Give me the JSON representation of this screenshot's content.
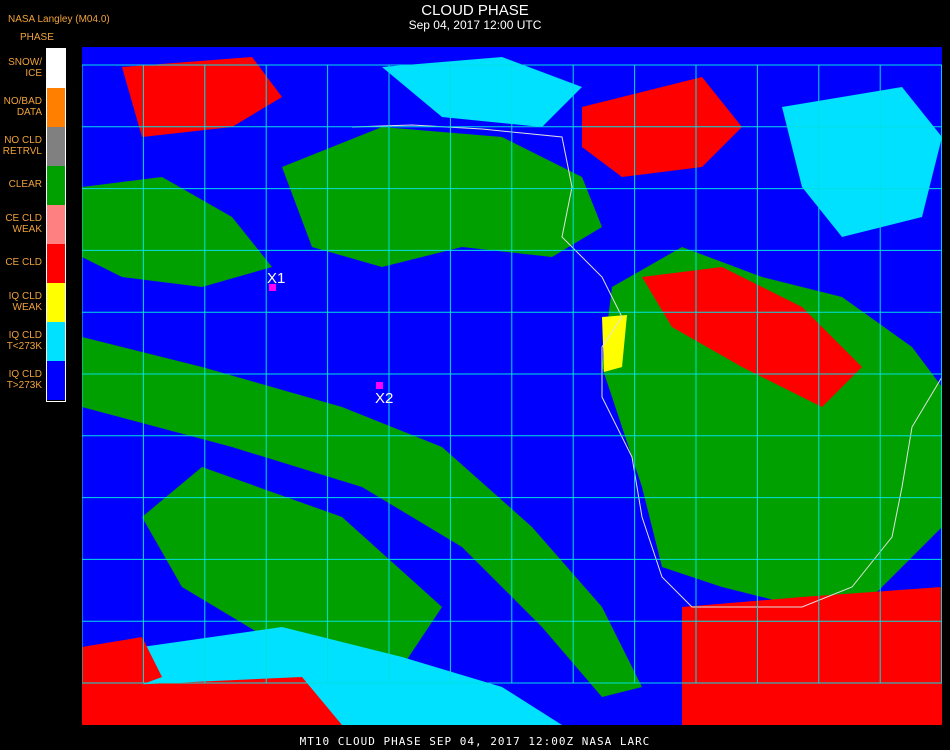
{
  "header": {
    "source": "NASA Langley (M04.0)",
    "phase_label": "PHASE",
    "title": "CLOUD PHASE",
    "datetime": "Sep 04, 2017 12:00 UTC"
  },
  "legend": [
    {
      "label_lines": [
        "SNOW/",
        "ICE"
      ],
      "color": "#ffffff"
    },
    {
      "label_lines": [
        "NO/BAD",
        "DATA"
      ],
      "color": "#ff8000"
    },
    {
      "label_lines": [
        "NO CLD",
        "RETRVL"
      ],
      "color": "#808080"
    },
    {
      "label_lines": [
        "CLEAR"
      ],
      "color": "#00a000"
    },
    {
      "label_lines": [
        "CE CLD",
        "WEAK"
      ],
      "color": "#ff8080"
    },
    {
      "label_lines": [
        "CE CLD"
      ],
      "color": "#ff0000"
    },
    {
      "label_lines": [
        "IQ CLD",
        "WEAK"
      ],
      "color": "#ffff00"
    },
    {
      "label_lines": [
        "IQ CLD",
        "T<273K"
      ],
      "color": "#00e0ff"
    },
    {
      "label_lines": [
        "IQ CLD",
        "T>273K"
      ],
      "color": "#0000ff"
    }
  ],
  "markers": [
    {
      "label": "X1"
    },
    {
      "label": "X2"
    }
  ],
  "footer": "MT10  CLOUD PHASE   SEP 04, 2017 12:00Z   NASA LARC",
  "colors": {
    "ocean_liquid": "#0000ff",
    "clear": "#00a000",
    "ice": "#ff0000",
    "supercooled": "#00e0ff",
    "grid": "#00e0e0",
    "marker": "#ff00ff"
  }
}
